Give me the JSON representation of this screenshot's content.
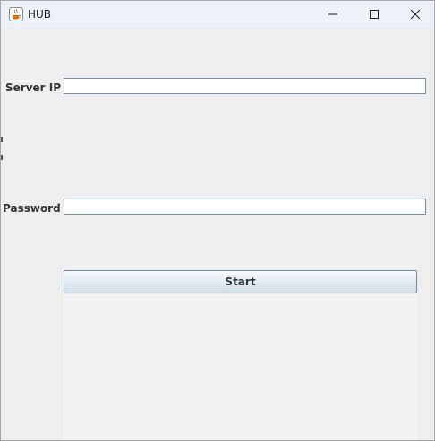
{
  "window": {
    "title": "HUB",
    "icon": "java-cup-icon"
  },
  "titlebar_controls": {
    "minimize": "minimize-icon",
    "maximize": "maximize-icon",
    "close": "close-icon"
  },
  "form": {
    "server_ip_label": "Server IP",
    "server_ip_value": "",
    "password_label": "Password",
    "password_value": "",
    "start_label": "Start"
  },
  "output": {
    "text": ""
  }
}
